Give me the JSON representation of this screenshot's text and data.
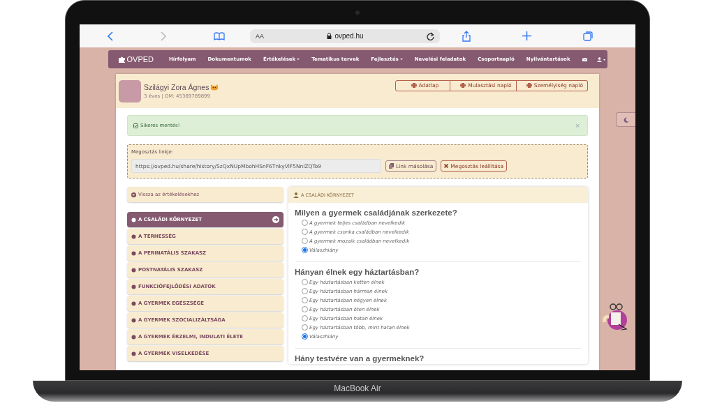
{
  "device": {
    "label": "MacBook Air"
  },
  "browser": {
    "text_size": "AA",
    "address": "ovped.hu"
  },
  "nav": {
    "logo": "OVPED",
    "items": [
      {
        "label": "Hírfolyam",
        "dropdown": false
      },
      {
        "label": "Dokumentumok",
        "dropdown": false
      },
      {
        "label": "Értékelések",
        "dropdown": true
      },
      {
        "label": "Tematikus tervek",
        "dropdown": false
      },
      {
        "label": "Fejlesztés",
        "dropdown": true
      },
      {
        "label": "Nevelési feladatok",
        "dropdown": false
      },
      {
        "label": "Csoportnapló",
        "dropdown": false
      },
      {
        "label": "Nyilvántartások",
        "dropdown": false
      }
    ]
  },
  "child": {
    "name": "Szilágyi Zora Ágnes",
    "meta": "3 éves | OM: 45369789899",
    "buttons": [
      "Adatlap",
      "Mulasztási napló",
      "Személyiség napló"
    ]
  },
  "alert": {
    "text": "Sikeres mentés!",
    "close": "×"
  },
  "share": {
    "label": "Megosztás linkje:",
    "link": "https://ovped.hu/share/history/SzQxNUpMbohHSnF6TnkyVlF5NnlZQTo9",
    "copy_button": "Link másolása",
    "stop_button": "Megosztás leállítása"
  },
  "sidebar": {
    "back": "Vissza az értékelésekhez",
    "items": [
      {
        "label": "A CSALÁDI KÖRNYEZET",
        "selected": true
      },
      {
        "label": "A TERHESSÉG",
        "selected": false
      },
      {
        "label": "A PERINATÁLIS SZAKASZ",
        "selected": false
      },
      {
        "label": "POSTNATÁLIS SZAKASZ",
        "selected": false
      },
      {
        "label": "FUNKCIÓFEJLŐDÉSI ADATOK",
        "selected": false
      },
      {
        "label": "A GYERMEK EGÉSZSÉGE",
        "selected": false
      },
      {
        "label": "A GYERMEK SZOCIALIZÁLTSÁGA",
        "selected": false
      },
      {
        "label": "A GYERMEK ÉRZELMI, INDULATI ÉLETE",
        "selected": false
      },
      {
        "label": "A GYERMEK VISELKEDÉSE",
        "selected": false
      }
    ]
  },
  "panel": {
    "title": "A CSALÁDI KÖRNYEZET",
    "questions": [
      {
        "question": "Milyen a gyermek családjának szerkezete?",
        "options": [
          {
            "label": "A gyermek teljes családban nevelkedik",
            "selected": false
          },
          {
            "label": "A gyermek csonka családban nevelkedik",
            "selected": false
          },
          {
            "label": "A gyermek mozaik családban nevelkedik",
            "selected": false
          },
          {
            "label": "Válaszhiány",
            "selected": true
          }
        ]
      },
      {
        "question": "Hányan élnek egy háztartásban?",
        "options": [
          {
            "label": "Egy háztartásban ketten élnek",
            "selected": false
          },
          {
            "label": "Egy háztartásban hárman élnek",
            "selected": false
          },
          {
            "label": "Egy háztartásban négyen élnek",
            "selected": false
          },
          {
            "label": "Egy háztartásban öten élnek",
            "selected": false
          },
          {
            "label": "Egy háztartásban hatan élnek",
            "selected": false
          },
          {
            "label": "Egy háztartásban több, mint hatan élnek",
            "selected": false
          },
          {
            "label": "Válaszhiány",
            "selected": true
          }
        ]
      },
      {
        "question": "Hány testvére van a gyermeknek?"
      }
    ]
  }
}
